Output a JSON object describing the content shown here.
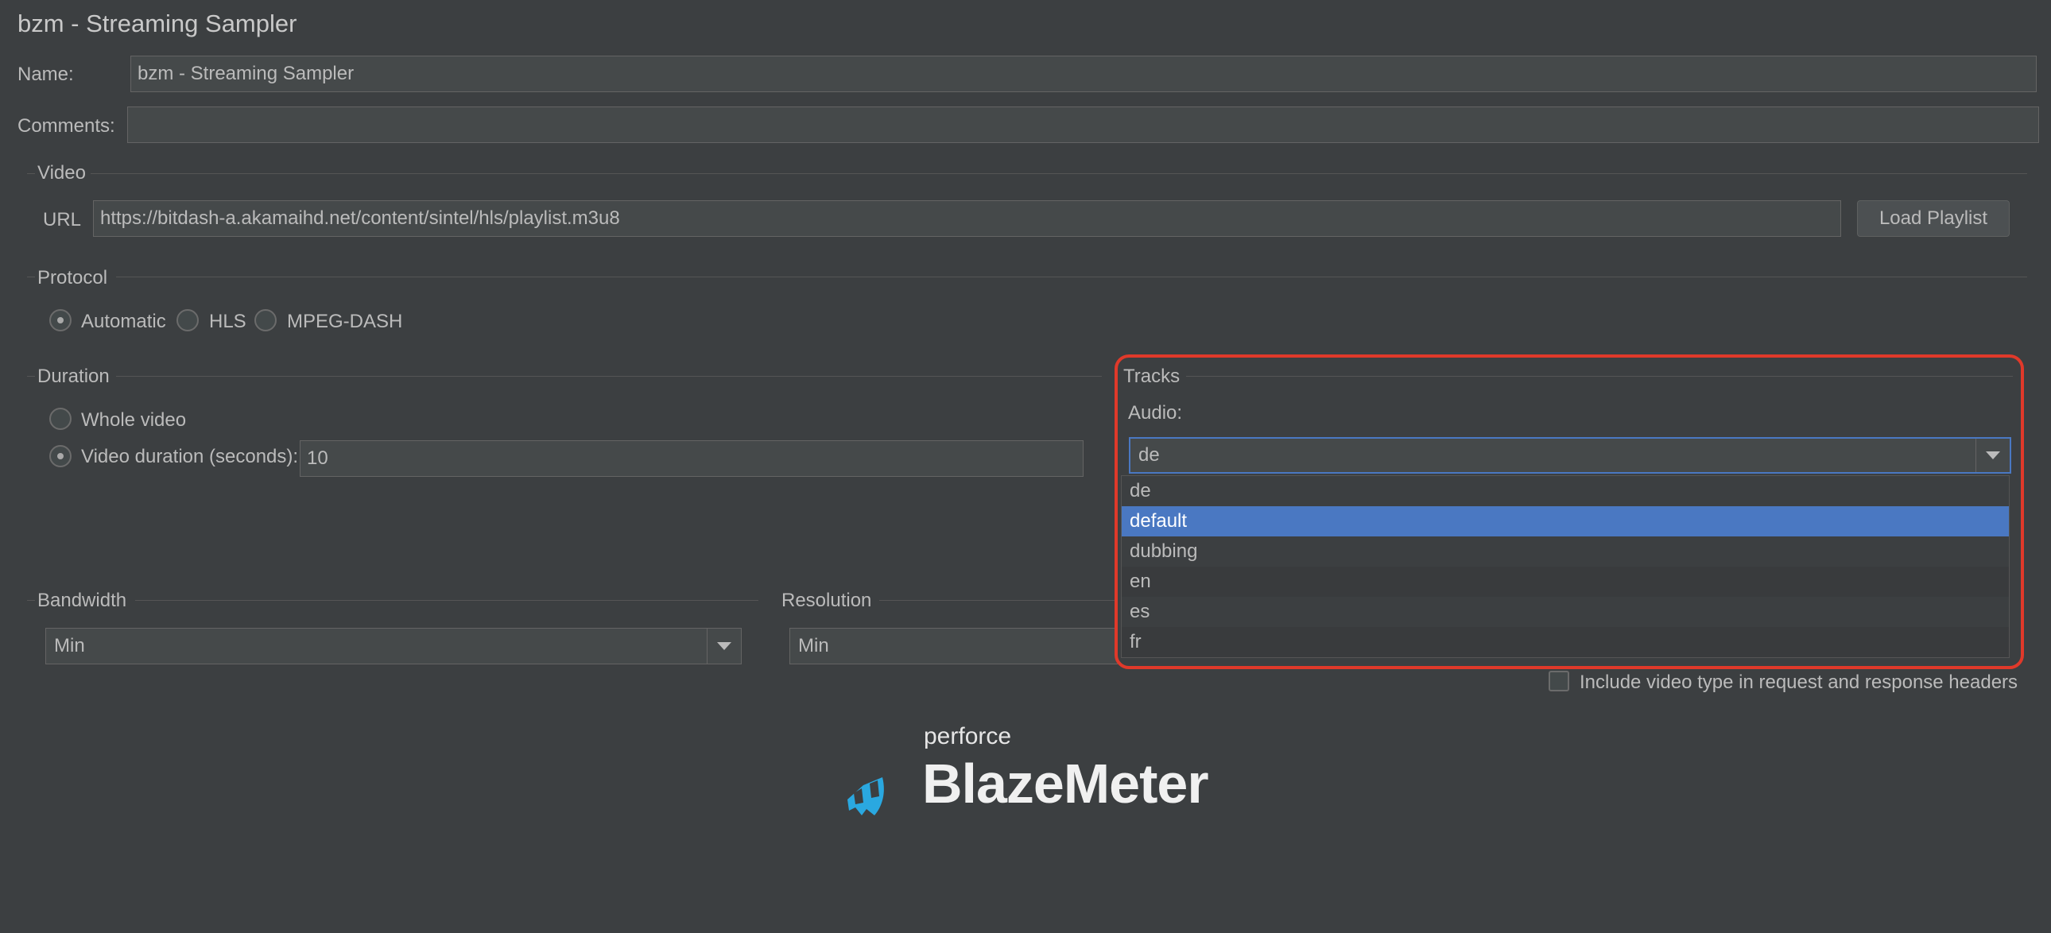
{
  "window_title": "bzm - Streaming Sampler",
  "name": {
    "label": "Name:",
    "value": "bzm - Streaming Sampler"
  },
  "comments": {
    "label": "Comments:",
    "value": ""
  },
  "video": {
    "section_label": "Video",
    "url_label": "URL",
    "url_value": "https://bitdash-a.akamaihd.net/content/sintel/hls/playlist.m3u8",
    "load_button": "Load Playlist"
  },
  "protocol": {
    "section_label": "Protocol",
    "options": [
      "Automatic",
      "HLS",
      "MPEG-DASH"
    ],
    "selected": "Automatic"
  },
  "duration": {
    "section_label": "Duration",
    "whole_video_label": "Whole video",
    "video_duration_label": "Video duration (seconds):",
    "video_duration_value": "10",
    "selected": "Video duration (seconds):"
  },
  "tracks": {
    "section_label": "Tracks",
    "audio_label": "Audio:",
    "audio_selected": "de",
    "audio_options": [
      "de",
      "default",
      "dubbing",
      "en",
      "es",
      "fr"
    ],
    "highlighted_option": "default"
  },
  "bandwidth": {
    "section_label": "Bandwidth",
    "value": "Min"
  },
  "resolution": {
    "section_label": "Resolution",
    "value": "Min"
  },
  "include_video_type": {
    "label": "Include video type in request and response headers",
    "checked": false
  },
  "logo": {
    "small": "perforce",
    "big": "BlazeMeter"
  },
  "colors": {
    "background": "#3c3f41",
    "selection": "#4a78c2",
    "highlight_border": "#e0392a",
    "logo_blue": "#2aa8e0"
  }
}
